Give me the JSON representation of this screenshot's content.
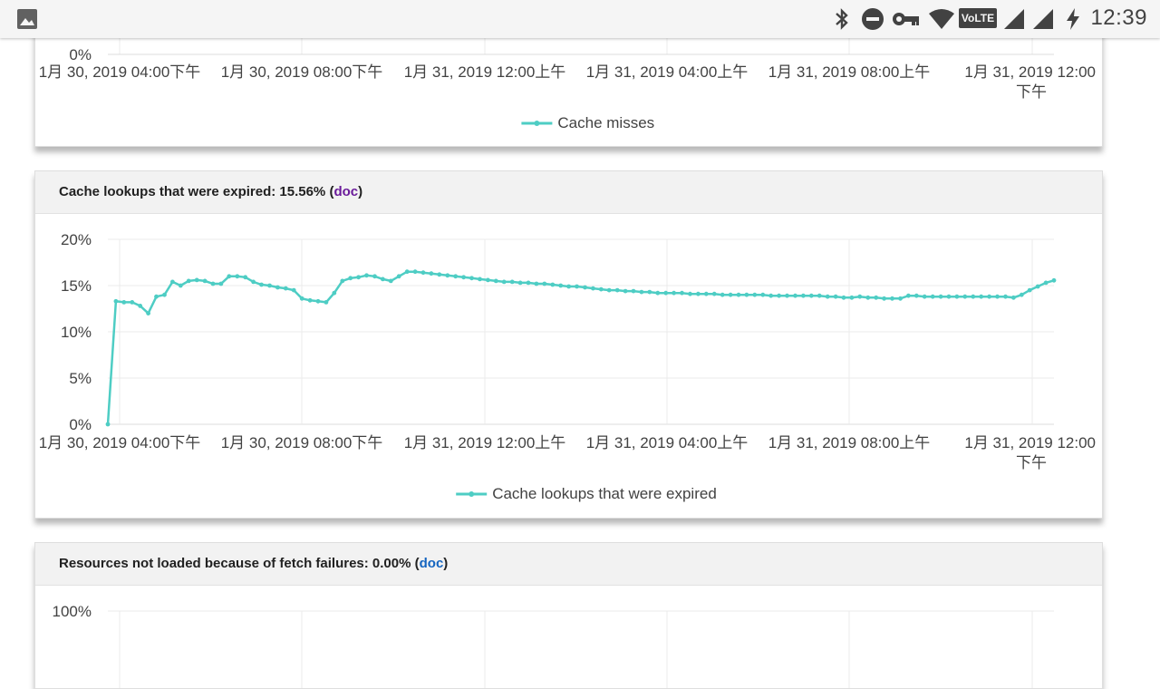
{
  "status_bar": {
    "time": "12:39",
    "icons": [
      "image-icon",
      "bluetooth-icon",
      "do-not-disturb-icon",
      "vpn-key-icon",
      "wifi-icon",
      "volte-icon",
      "signal-icon",
      "signal-icon",
      "charging-icon"
    ],
    "volte_label": "VoLTE"
  },
  "colors": {
    "series": "#4ecdc4",
    "grid": "#ebebeb",
    "doc_visited": "#6a1b9a",
    "doc_link": "#1565c0"
  },
  "x_axis_ticks": [
    [
      "1月 30, 2019 04:00下午"
    ],
    [
      "1月 30, 2019 08:00下午"
    ],
    [
      "1月 31, 2019 12:00上午"
    ],
    [
      "1月 31, 2019 04:00上午"
    ],
    [
      "1月 31, 2019 08:00上午"
    ],
    [
      "1月 31, 2019 12:00",
      "下午"
    ]
  ],
  "cards": [
    {
      "title": "",
      "visible_y_tick": "0%",
      "legend": "Cache misses"
    },
    {
      "title_prefix": "Cache lookups that were expired: 15.56% (",
      "doc_label": "doc",
      "title_suffix": ")",
      "legend": "Cache lookups that were expired"
    },
    {
      "title_prefix": "Resources not loaded because of fetch failures: 0.00% (",
      "doc_label": "doc",
      "title_suffix": ")",
      "visible_y_tick": "100%"
    }
  ],
  "chart_data": [
    {
      "type": "line",
      "title": "Cache lookups that were expired: 15.56%",
      "xlabel": "",
      "ylabel": "",
      "x_ticks": [
        "1月 30, 2019 04:00下午",
        "1月 30, 2019 08:00下午",
        "1月 31, 2019 12:00上午",
        "1月 31, 2019 04:00上午",
        "1月 31, 2019 08:00上午",
        "1月 31, 2019 12:00下午"
      ],
      "y_ticks": [
        "0%",
        "5%",
        "10%",
        "15%",
        "20%"
      ],
      "ylim": [
        0,
        20
      ],
      "grid": true,
      "legend_position": "bottom",
      "series": [
        {
          "name": "Cache lookups that were expired",
          "values": [
            0.0,
            13.3,
            13.2,
            13.2,
            12.8,
            12.0,
            13.8,
            14.0,
            15.4,
            15.0,
            15.5,
            15.6,
            15.5,
            15.2,
            15.2,
            16.0,
            16.0,
            15.9,
            15.4,
            15.1,
            15.0,
            14.8,
            14.7,
            14.5,
            13.6,
            13.4,
            13.3,
            13.2,
            14.2,
            15.5,
            15.8,
            15.9,
            16.1,
            16.0,
            15.7,
            15.5,
            16.0,
            16.5,
            16.5,
            16.4,
            16.3,
            16.2,
            16.1,
            16.0,
            15.9,
            15.8,
            15.7,
            15.6,
            15.5,
            15.4,
            15.4,
            15.3,
            15.3,
            15.2,
            15.2,
            15.1,
            15.0,
            14.9,
            14.9,
            14.8,
            14.7,
            14.6,
            14.5,
            14.5,
            14.4,
            14.4,
            14.3,
            14.3,
            14.2,
            14.2,
            14.2,
            14.2,
            14.1,
            14.1,
            14.1,
            14.1,
            14.0,
            14.0,
            14.0,
            14.0,
            14.0,
            14.0,
            13.9,
            13.9,
            13.9,
            13.9,
            13.9,
            13.9,
            13.9,
            13.8,
            13.8,
            13.7,
            13.7,
            13.8,
            13.7,
            13.7,
            13.6,
            13.6,
            13.6,
            13.9,
            13.9,
            13.8,
            13.8,
            13.8,
            13.8,
            13.8,
            13.8,
            13.8,
            13.8,
            13.8,
            13.8,
            13.8,
            13.7,
            14.0,
            14.5,
            14.9,
            15.3,
            15.56
          ]
        }
      ]
    }
  ]
}
